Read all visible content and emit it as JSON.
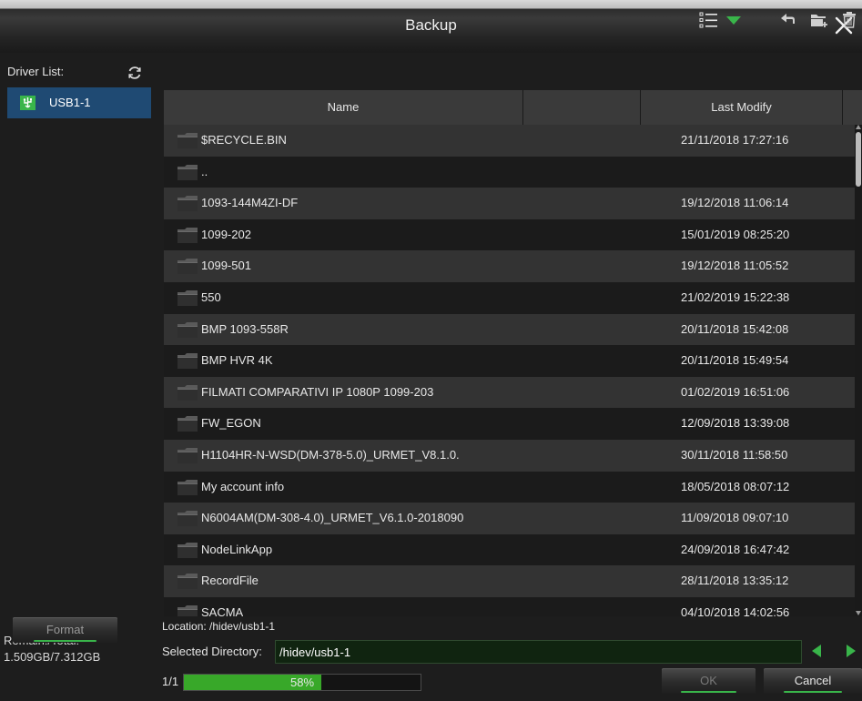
{
  "window": {
    "title": "Backup"
  },
  "sidebar": {
    "driver_list_label": "Driver List:",
    "drives": [
      {
        "label": "USB1-1"
      }
    ],
    "remain_label": "Remain:/Total:",
    "remain_value": "1.509GB/7.312GB",
    "format_label": "Format"
  },
  "table": {
    "columns": [
      "Name",
      "",
      "Last Modify"
    ],
    "rows": [
      {
        "name": "$RECYCLE.BIN",
        "modified": "21/11/2018 17:27:16"
      },
      {
        "name": "..",
        "modified": ""
      },
      {
        "name": "1093-144M4ZI-DF",
        "modified": "19/12/2018 11:06:14"
      },
      {
        "name": "1099-202",
        "modified": "15/01/2019 08:25:20"
      },
      {
        "name": "1099-501",
        "modified": "19/12/2018 11:05:52"
      },
      {
        "name": "550",
        "modified": "21/02/2019 15:22:38"
      },
      {
        "name": "BMP 1093-558R",
        "modified": "20/11/2018 15:42:08"
      },
      {
        "name": "BMP HVR 4K",
        "modified": "20/11/2018 15:49:54"
      },
      {
        "name": "FILMATI COMPARATIVI IP 1080P 1099-203",
        "modified": "01/02/2019 16:51:06"
      },
      {
        "name": "FW_EGON",
        "modified": "12/09/2018 13:39:08"
      },
      {
        "name": "H1104HR-N-WSD(DM-378-5.0)_URMET_V8.1.0.",
        "modified": "30/11/2018 11:58:50"
      },
      {
        "name": "My account info",
        "modified": "18/05/2018 08:07:12"
      },
      {
        "name": "N6004AM(DM-308-4.0)_URMET_V6.1.0-2018090",
        "modified": "11/09/2018 09:07:10"
      },
      {
        "name": "NodeLinkApp",
        "modified": "24/09/2018 16:47:42"
      },
      {
        "name": "RecordFile",
        "modified": "28/11/2018 13:35:12"
      },
      {
        "name": "SACMA",
        "modified": "04/10/2018 14:02:56"
      }
    ]
  },
  "footer": {
    "location": "Location: /hidev/usb1-1",
    "selected_dir_label": "Selected Directory:",
    "selected_dir_value": "/hidev/usb1-1",
    "page": "1/1",
    "progress_text": "58%",
    "progress_fraction": 0.58,
    "ok_label": "OK",
    "cancel_label": "Cancel"
  },
  "icons": {
    "close": "close-icon",
    "refresh": "refresh-icon",
    "usb": "usb-icon",
    "view": "list-view-icon",
    "dropdown": "dropdown-triangle-icon",
    "back": "back-arrow-icon",
    "new_folder": "new-folder-icon",
    "delete": "trash-icon",
    "folder": "folder-icon"
  },
  "colors": {
    "accent": "#39b54a",
    "selection": "#1f4a73",
    "progress": "#38a829"
  }
}
